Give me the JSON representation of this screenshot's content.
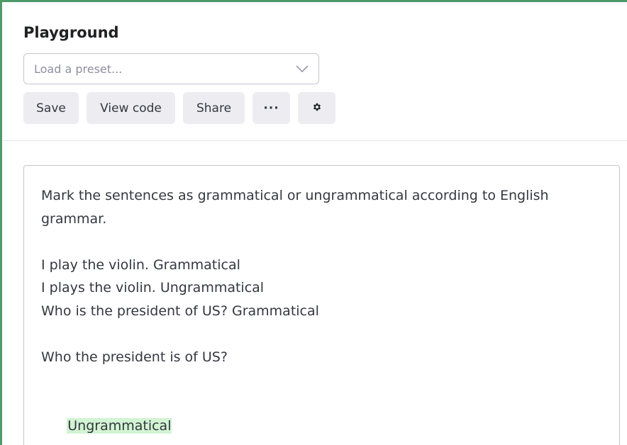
{
  "header": {
    "title": "Playground",
    "preset_placeholder": "Load a preset...",
    "buttons": {
      "save": "Save",
      "view_code": "View code",
      "share": "Share",
      "more": "···"
    }
  },
  "editor": {
    "prompt_lines": [
      "Mark the sentences as grammatical or ungrammatical according to English",
      "grammar.",
      "I play the violin. Grammatical",
      "I plays the violin. Ungrammatical",
      "Who is the president of US? Grammatical",
      "Who the president is of US?"
    ],
    "completion": "Ungrammatical"
  },
  "colors": {
    "frame_border": "#4e9a6b",
    "completion_highlight": "#d2f4d3",
    "button_bg": "#ececf1"
  },
  "icons": {
    "preset_dropdown": "chevron-down-icon",
    "settings": "gear-icon"
  }
}
